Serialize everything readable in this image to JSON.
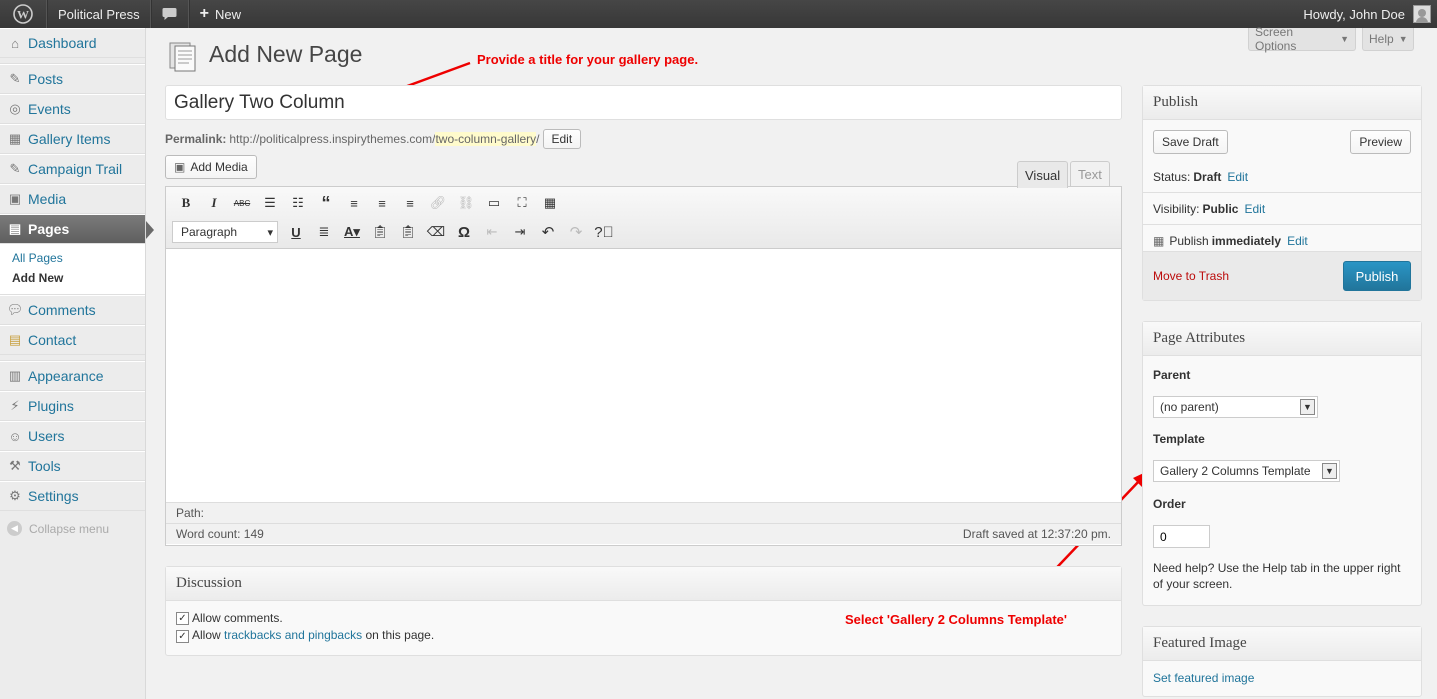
{
  "adminbar": {
    "site_name": "Political Press",
    "new_label": "New",
    "howdy": "Howdy, John Doe"
  },
  "sidebar": {
    "items": [
      {
        "label": "Dashboard",
        "icon": "home-icon"
      },
      {
        "label": "Posts",
        "icon": "pin-icon"
      },
      {
        "label": "Events",
        "icon": "target-icon"
      },
      {
        "label": "Gallery Items",
        "icon": "grid-icon"
      },
      {
        "label": "Campaign Trail",
        "icon": "pin-icon"
      },
      {
        "label": "Media",
        "icon": "media-icon"
      },
      {
        "label": "Pages",
        "icon": "pages-icon"
      },
      {
        "label": "Comments",
        "icon": "comment-icon"
      },
      {
        "label": "Contact",
        "icon": "contact-icon"
      },
      {
        "label": "Appearance",
        "icon": "appearance-icon"
      },
      {
        "label": "Plugins",
        "icon": "plugin-icon"
      },
      {
        "label": "Users",
        "icon": "users-icon"
      },
      {
        "label": "Tools",
        "icon": "tools-icon"
      },
      {
        "label": "Settings",
        "icon": "settings-icon"
      }
    ],
    "submenu": {
      "all_pages": "All Pages",
      "add_new": "Add New"
    },
    "collapse": "Collapse menu"
  },
  "header": {
    "screen_options": "Screen Options",
    "help": "Help",
    "title": "Add New Page"
  },
  "annotations": {
    "title_hint": "Provide a title for your gallery page.",
    "template_hint": "Select 'Gallery 2 Columns Template'"
  },
  "editor": {
    "title_value": "Gallery Two Column",
    "permalink_label": "Permalink:",
    "permalink_base": "http://politicalpress.inspirythemes.com/",
    "permalink_slug": "two-column-gallery",
    "permalink_end": "/",
    "edit_label": "Edit",
    "add_media": "Add Media",
    "tab_visual": "Visual",
    "tab_text": "Text",
    "format_value": "Paragraph",
    "path_label": "Path:",
    "word_count": "Word count: 149",
    "draft_saved": "Draft saved at 12:37:20 pm."
  },
  "discussion": {
    "title": "Discussion",
    "allow_comments": "Allow comments.",
    "allow_prefix": "Allow",
    "trackbacks_link": "trackbacks and pingbacks",
    "allow_suffix": "on this page."
  },
  "publish": {
    "title": "Publish",
    "save_draft": "Save Draft",
    "preview": "Preview",
    "status_label": "Status:",
    "status_value": "Draft",
    "visibility_label": "Visibility:",
    "visibility_value": "Public",
    "publish_label": "Publish",
    "publish_value": "immediately",
    "edit": "Edit",
    "trash": "Move to Trash",
    "publish_button": "Publish"
  },
  "page_attributes": {
    "title": "Page Attributes",
    "parent_label": "Parent",
    "parent_value": "(no parent)",
    "template_label": "Template",
    "template_value": "Gallery 2 Columns Template",
    "order_label": "Order",
    "order_value": "0",
    "help_text": "Need help? Use the Help tab in the upper right of your screen."
  },
  "featured_image": {
    "title": "Featured Image",
    "link": "Set featured image"
  },
  "colors": {
    "link": "#21759b",
    "annotation": "#ee0000",
    "primary_button": "#21759b"
  }
}
